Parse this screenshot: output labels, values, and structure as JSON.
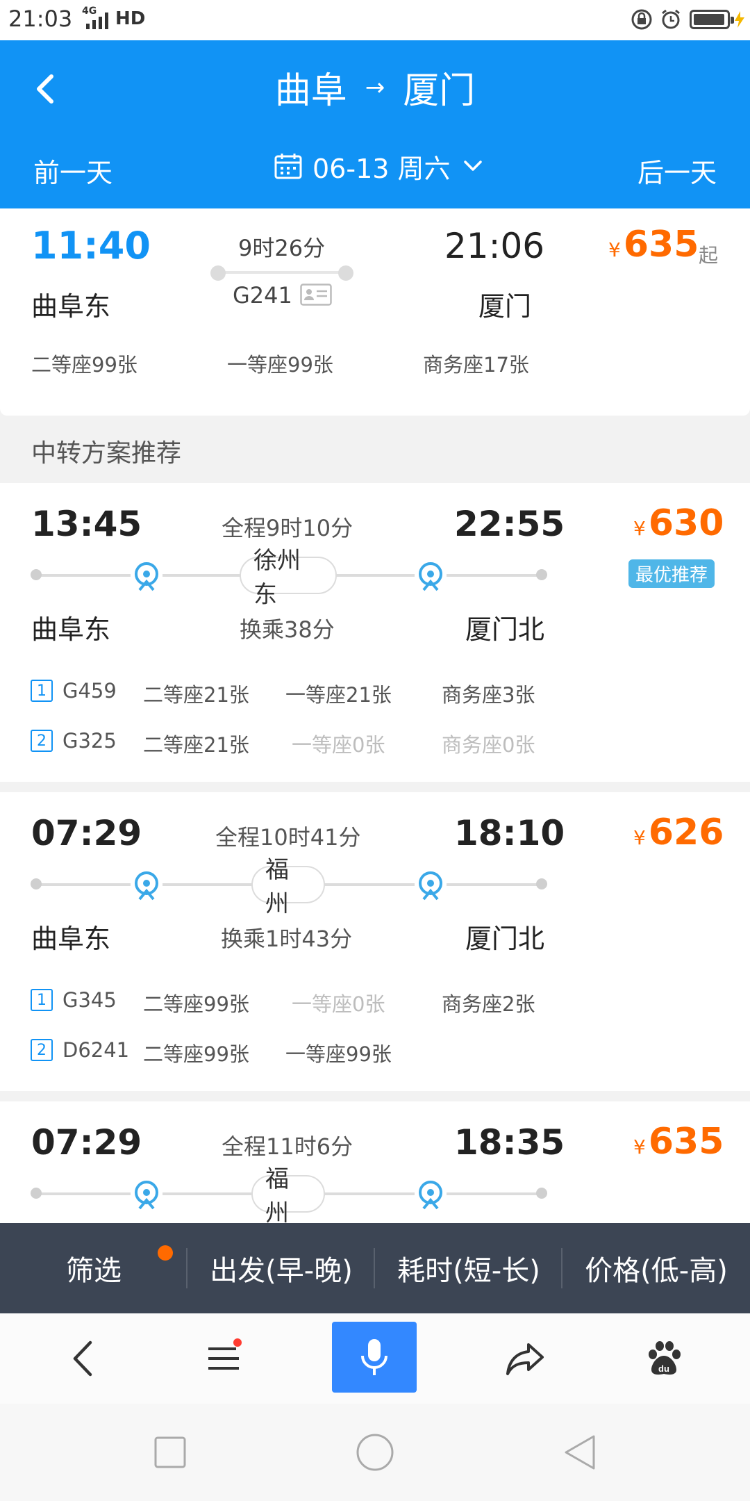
{
  "status_bar": {
    "time": "21:03",
    "network": "4G",
    "hd": "HD"
  },
  "header": {
    "from": "曲阜",
    "arrow": "→",
    "to": "厦门",
    "prev_day": "前一天",
    "next_day": "后一天",
    "date": "06-13 周六"
  },
  "direct_train": {
    "depart_time": "11:40",
    "duration": "9时26分",
    "arrive_time": "21:06",
    "train_no": "G241",
    "from_station": "曲阜东",
    "to_station": "厦门",
    "price_symbol": "¥",
    "price": "635",
    "price_suffix": "起",
    "seats": [
      "二等座99张",
      "一等座99张",
      "商务座17张"
    ]
  },
  "section_title": "中转方案推荐",
  "transfers": [
    {
      "depart_time": "13:45",
      "total": "全程9时10分",
      "arrive_time": "22:55",
      "price_symbol": "¥",
      "price": "630",
      "badge": "最优推荐",
      "transfer_station": "徐州东",
      "from_station": "曲阜东",
      "transfer_time": "换乘38分",
      "to_station": "厦门北",
      "legs": [
        {
          "num": "1",
          "train": "G459",
          "seats": [
            "二等座21张",
            "一等座21张",
            "商务座3张"
          ],
          "dim": [
            false,
            false,
            false
          ]
        },
        {
          "num": "2",
          "train": "G325",
          "seats": [
            "二等座21张",
            "一等座0张",
            "商务座0张"
          ],
          "dim": [
            false,
            true,
            true
          ]
        }
      ]
    },
    {
      "depart_time": "07:29",
      "total": "全程10时41分",
      "arrive_time": "18:10",
      "price_symbol": "¥",
      "price": "626",
      "transfer_station": "福州",
      "from_station": "曲阜东",
      "transfer_time": "换乘1时43分",
      "to_station": "厦门北",
      "legs": [
        {
          "num": "1",
          "train": "G345",
          "seats": [
            "二等座99张",
            "一等座0张",
            "商务座2张"
          ],
          "dim": [
            false,
            true,
            false
          ]
        },
        {
          "num": "2",
          "train": "D6241",
          "seats": [
            "二等座99张",
            "一等座99张"
          ],
          "dim": [
            false,
            false
          ]
        }
      ]
    },
    {
      "depart_time": "07:29",
      "total": "全程11时6分",
      "arrive_time": "18:35",
      "price_symbol": "¥",
      "price": "635",
      "transfer_station": "福州"
    }
  ],
  "filter_bar": {
    "items": [
      "筛选",
      "出发(早-晚)",
      "耗时(短-长)",
      "价格(低-高)"
    ]
  },
  "browser_bar": {
    "icons": [
      "back-icon",
      "menu-icon",
      "microphone-icon",
      "share-icon",
      "baidu-paw-icon"
    ]
  },
  "system_nav": {
    "icons": [
      "recent-apps-icon",
      "home-icon",
      "back-triangle-icon"
    ]
  },
  "colors": {
    "primary": "#1193f5",
    "price": "#ff6a00",
    "badge": "#4fb6e8",
    "filter_bg": "#3c4554",
    "mic": "#3388ff"
  }
}
